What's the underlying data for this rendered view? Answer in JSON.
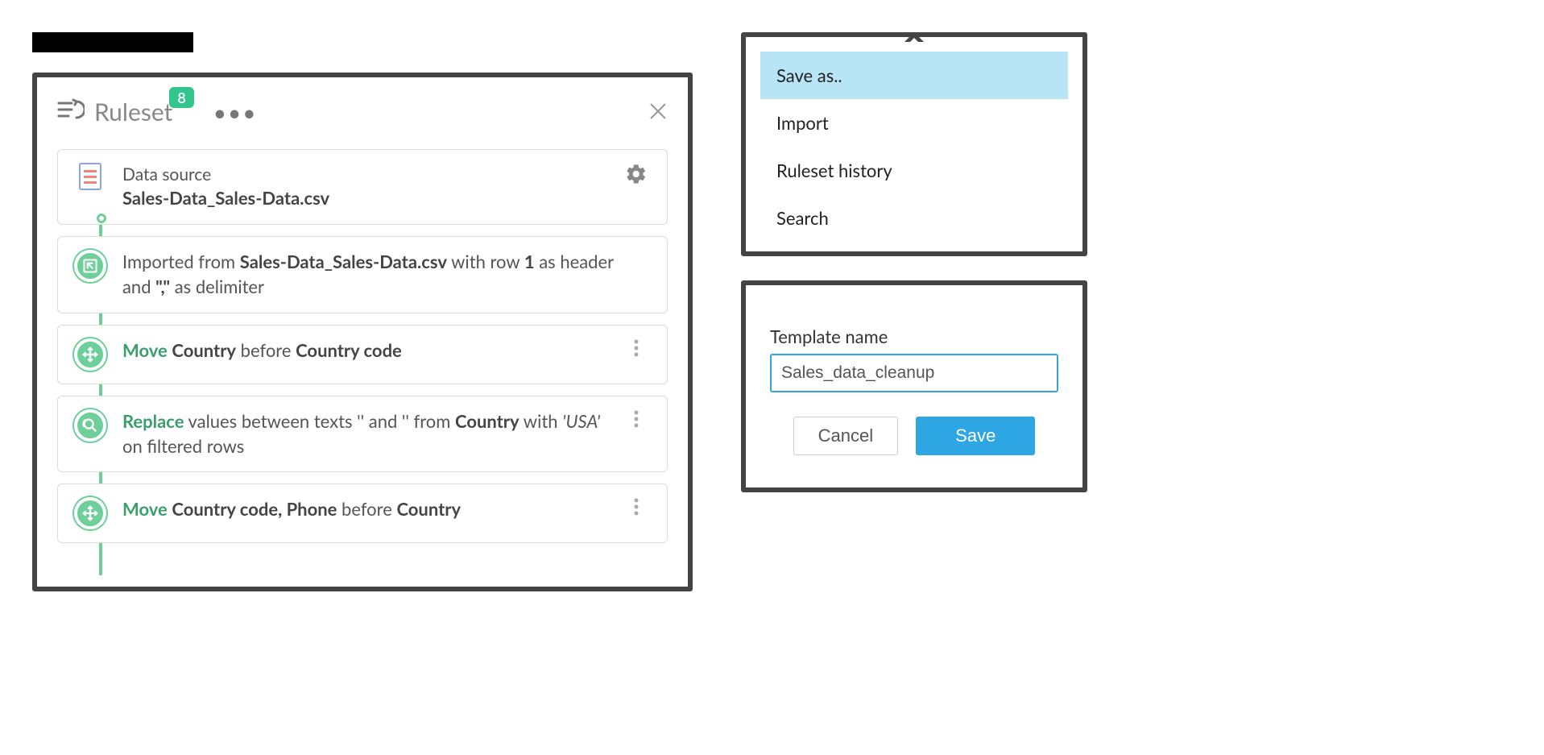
{
  "ruleset": {
    "title": "Ruleset",
    "badge": "8",
    "datasource": {
      "label": "Data source",
      "name": "Sales-Data_Sales-Data.csv"
    },
    "steps": [
      {
        "kind": "import",
        "prefix": "Imported from ",
        "file": "Sales-Data_Sales-Data.csv",
        "suffix1": " with row ",
        "row": "1",
        "suffix2": " as header and ",
        "delim": "\",\"",
        "suffix3": " as delimiter"
      },
      {
        "kind": "move",
        "verb": "Move",
        "cols": "Country",
        "mid": " before ",
        "target": "Country code"
      },
      {
        "kind": "replace",
        "verb": "Replace",
        "mid1": " values between texts '' and '' from ",
        "col": "Country",
        "mid2": " with ",
        "value": "'USA'",
        "suffix": " on filtered rows"
      },
      {
        "kind": "move",
        "verb": "Move",
        "cols": "Country code, Phone",
        "mid": " before ",
        "target": "Country"
      }
    ]
  },
  "menu": {
    "items": [
      "Save as..",
      "Import",
      "Ruleset history",
      "Search"
    ],
    "highlightIndex": 0
  },
  "template": {
    "label": "Template name",
    "value": "Sales_data_cleanup",
    "cancel": "Cancel",
    "save": "Save"
  }
}
